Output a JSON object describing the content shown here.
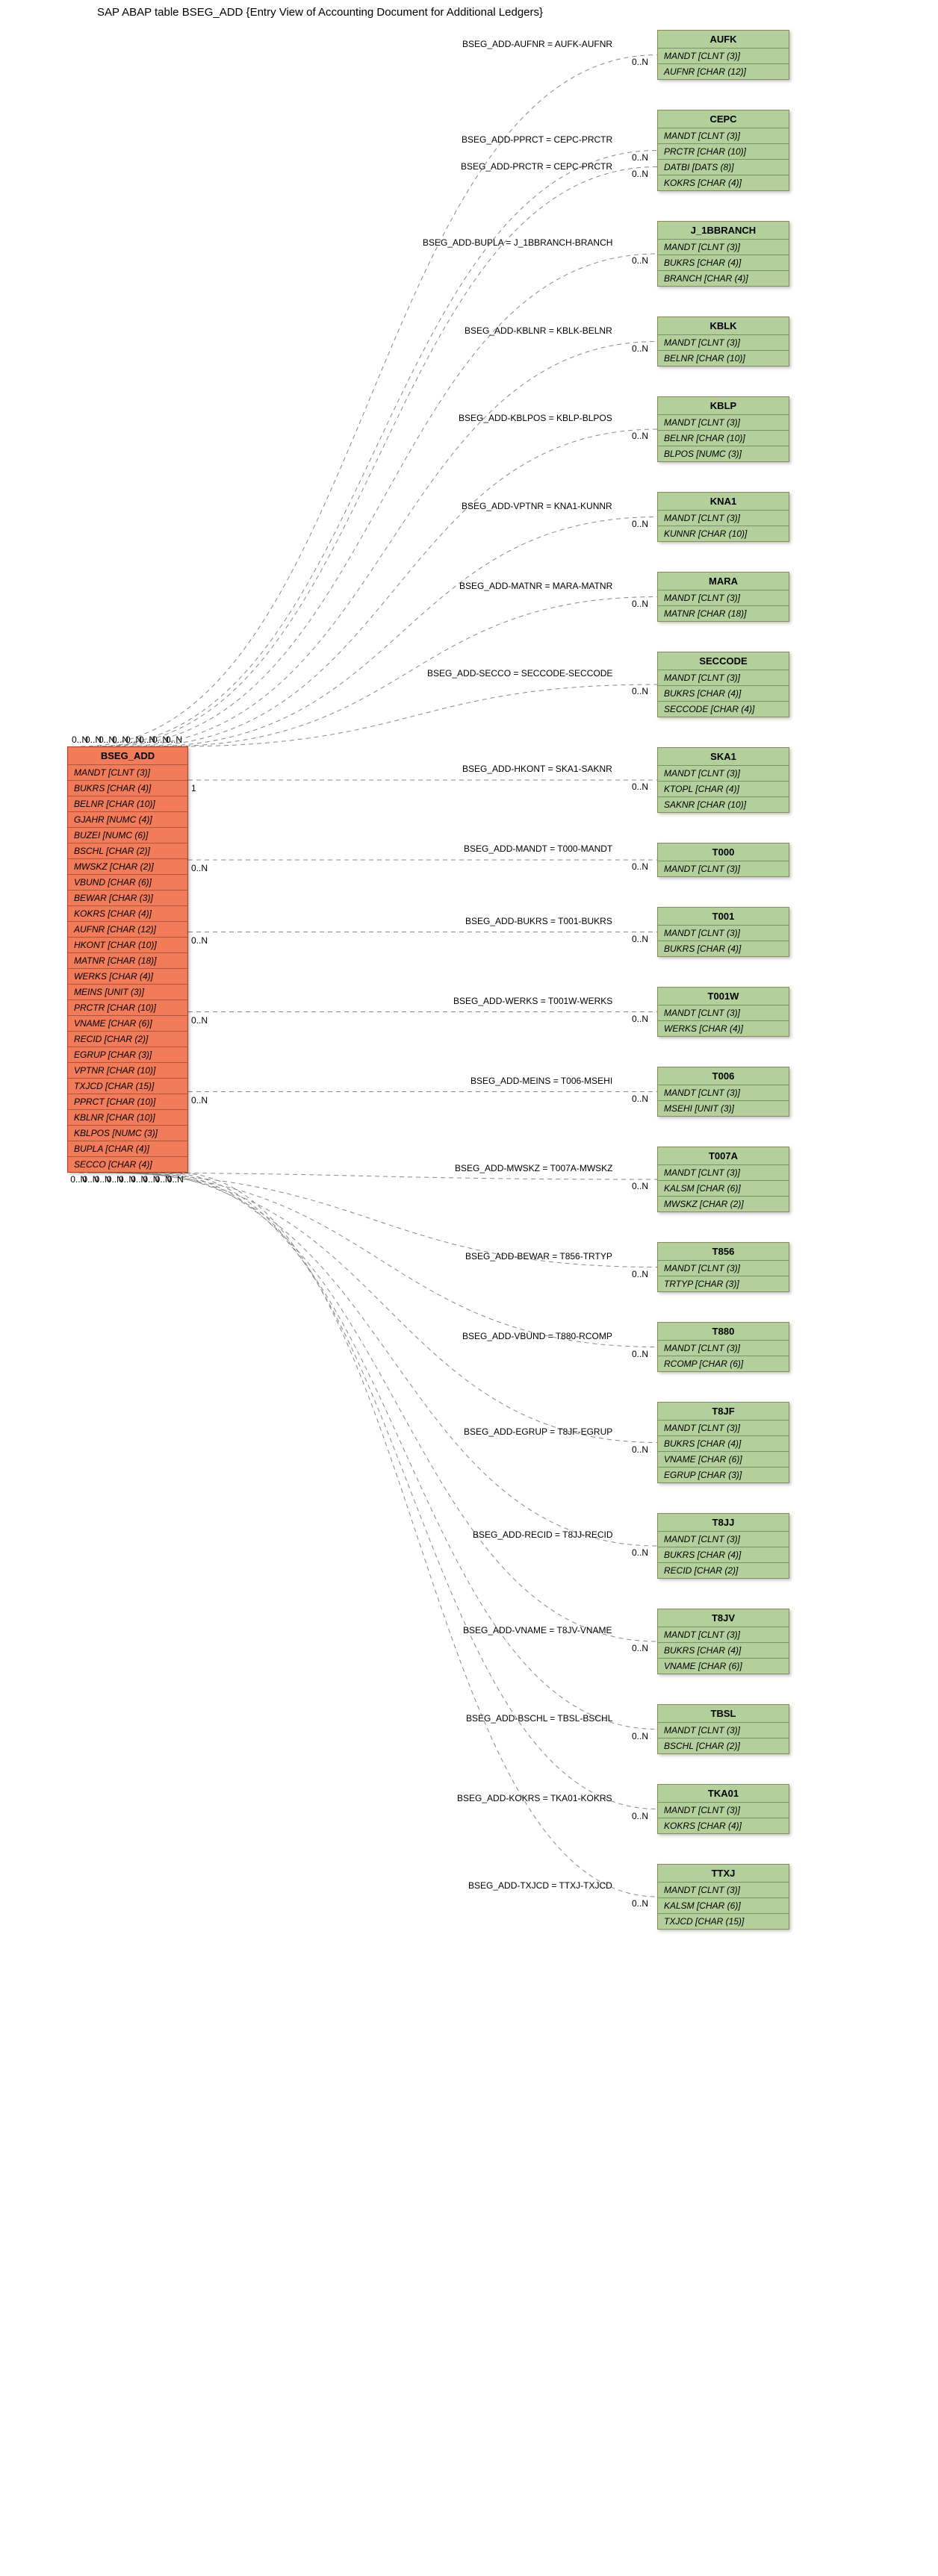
{
  "title": "SAP ABAP table BSEG_ADD {Entry View of Accounting Document for Additional Ledgers}",
  "main_entity": {
    "name": "BSEG_ADD",
    "fields": [
      "MANDT [CLNT (3)]",
      "BUKRS [CHAR (4)]",
      "BELNR [CHAR (10)]",
      "GJAHR [NUMC (4)]",
      "BUZEI [NUMC (6)]",
      "BSCHL [CHAR (2)]",
      "MWSKZ [CHAR (2)]",
      "VBUND [CHAR (6)]",
      "BEWAR [CHAR (3)]",
      "KOKRS [CHAR (4)]",
      "AUFNR [CHAR (12)]",
      "HKONT [CHAR (10)]",
      "MATNR [CHAR (18)]",
      "WERKS [CHAR (4)]",
      "MEINS [UNIT (3)]",
      "PRCTR [CHAR (10)]",
      "VNAME [CHAR (6)]",
      "RECID [CHAR (2)]",
      "EGRUP [CHAR (3)]",
      "VPTNR [CHAR (10)]",
      "TXJCD [CHAR (15)]",
      "PPRCT [CHAR (10)]",
      "KBLNR [CHAR (10)]",
      "KBLPOS [NUMC (3)]",
      "BUPLA [CHAR (4)]",
      "SECCO [CHAR (4)]"
    ]
  },
  "targets": [
    {
      "name": "AUFK",
      "fields": [
        "MANDT [CLNT (3)]",
        "AUFNR [CHAR (12)]"
      ],
      "rel_label": "BSEG_ADD-AUFNR = AUFK-AUFNR",
      "near_card": "0..N",
      "far_card": "0..N"
    },
    {
      "name": "CEPC",
      "fields": [
        "MANDT [CLNT (3)]",
        "PRCTR [CHAR (10)]",
        "DATBI [DATS (8)]",
        "KOKRS [CHAR (4)]"
      ],
      "rel_label": "BSEG_ADD-PPRCT = CEPC-PRCTR",
      "near_card": "0..N",
      "far_card": "0..N",
      "extra_rel_label": "BSEG_ADD-PRCTR = CEPC-PRCTR",
      "extra_near_card": "0..N",
      "extra_far_card": "0..N"
    },
    {
      "name": "J_1BBRANCH",
      "fields": [
        "MANDT [CLNT (3)]",
        "BUKRS [CHAR (4)]",
        "BRANCH [CHAR (4)]"
      ],
      "rel_label": "BSEG_ADD-BUPLA = J_1BBRANCH-BRANCH",
      "near_card": "0..N",
      "far_card": "0..N"
    },
    {
      "name": "KBLK",
      "fields": [
        "MANDT [CLNT (3)]",
        "BELNR [CHAR (10)]"
      ],
      "rel_label": "BSEG_ADD-KBLNR = KBLK-BELNR",
      "near_card": "0..N",
      "far_card": "0..N"
    },
    {
      "name": "KBLP",
      "fields": [
        "MANDT [CLNT (3)]",
        "BELNR [CHAR (10)]",
        "BLPOS [NUMC (3)]"
      ],
      "rel_label": "BSEG_ADD-KBLPOS = KBLP-BLPOS",
      "near_card": "0..N",
      "far_card": "0..N"
    },
    {
      "name": "KNA1",
      "fields": [
        "MANDT [CLNT (3)]",
        "KUNNR [CHAR (10)]"
      ],
      "rel_label": "BSEG_ADD-VPTNR = KNA1-KUNNR",
      "near_card": "0..N",
      "far_card": "0..N"
    },
    {
      "name": "MARA",
      "fields": [
        "MANDT [CLNT (3)]",
        "MATNR [CHAR (18)]"
      ],
      "rel_label": "BSEG_ADD-MATNR = MARA-MATNR",
      "near_card": "0..N",
      "far_card": "0..N"
    },
    {
      "name": "SECCODE",
      "fields": [
        "MANDT [CLNT (3)]",
        "BUKRS [CHAR (4)]",
        "SECCODE [CHAR (4)]"
      ],
      "rel_label": "BSEG_ADD-SECCO = SECCODE-SECCODE",
      "near_card": "0..N",
      "far_card": "0..N"
    },
    {
      "name": "SKA1",
      "fields": [
        "MANDT [CLNT (3)]",
        "KTOPL [CHAR (4)]",
        "SAKNR [CHAR (10)]"
      ],
      "rel_label": "BSEG_ADD-HKONT = SKA1-SAKNR",
      "near_card": "1",
      "far_card": "0..N"
    },
    {
      "name": "T000",
      "fields": [
        "MANDT [CLNT (3)]"
      ],
      "rel_label": "BSEG_ADD-MANDT = T000-MANDT",
      "near_card": "0..N",
      "far_card": "0..N"
    },
    {
      "name": "T001",
      "fields": [
        "MANDT [CLNT (3)]",
        "BUKRS [CHAR (4)]"
      ],
      "rel_label": "BSEG_ADD-BUKRS = T001-BUKRS",
      "near_card": "0..N",
      "far_card": "0..N"
    },
    {
      "name": "T001W",
      "fields": [
        "MANDT [CLNT (3)]",
        "WERKS [CHAR (4)]"
      ],
      "rel_label": "BSEG_ADD-WERKS = T001W-WERKS",
      "near_card": "0..N",
      "far_card": "0..N"
    },
    {
      "name": "T006",
      "fields": [
        "MANDT [CLNT (3)]",
        "MSEHI [UNIT (3)]"
      ],
      "rel_label": "BSEG_ADD-MEINS = T006-MSEHI",
      "near_card": "0..N",
      "far_card": "0..N"
    },
    {
      "name": "T007A",
      "fields": [
        "MANDT [CLNT (3)]",
        "KALSM [CHAR (6)]",
        "MWSKZ [CHAR (2)]"
      ],
      "rel_label": "BSEG_ADD-MWSKZ = T007A-MWSKZ",
      "near_card": "0..N",
      "far_card": "0..N"
    },
    {
      "name": "T856",
      "fields": [
        "MANDT [CLNT (3)]",
        "TRTYP [CHAR (3)]"
      ],
      "rel_label": "BSEG_ADD-BEWAR = T856-TRTYP",
      "near_card": "0..N",
      "far_card": "0..N"
    },
    {
      "name": "T880",
      "fields": [
        "MANDT [CLNT (3)]",
        "RCOMP [CHAR (6)]"
      ],
      "rel_label": "BSEG_ADD-VBUND = T880-RCOMP",
      "near_card": "0..N",
      "far_card": "0..N"
    },
    {
      "name": "T8JF",
      "fields": [
        "MANDT [CLNT (3)]",
        "BUKRS [CHAR (4)]",
        "VNAME [CHAR (6)]",
        "EGRUP [CHAR (3)]"
      ],
      "rel_label": "BSEG_ADD-EGRUP = T8JF-EGRUP",
      "near_card": "0..N",
      "far_card": "0..N"
    },
    {
      "name": "T8JJ",
      "fields": [
        "MANDT [CLNT (3)]",
        "BUKRS [CHAR (4)]",
        "RECID [CHAR (2)]"
      ],
      "rel_label": "BSEG_ADD-RECID = T8JJ-RECID",
      "near_card": "0..N",
      "far_card": "0..N"
    },
    {
      "name": "T8JV",
      "fields": [
        "MANDT [CLNT (3)]",
        "BUKRS [CHAR (4)]",
        "VNAME [CHAR (6)]"
      ],
      "rel_label": "BSEG_ADD-VNAME = T8JV-VNAME",
      "near_card": "0..N",
      "far_card": "0..N"
    },
    {
      "name": "TBSL",
      "fields": [
        "MANDT [CLNT (3)]",
        "BSCHL [CHAR (2)]"
      ],
      "rel_label": "BSEG_ADD-BSCHL = TBSL-BSCHL",
      "near_card": "0..N",
      "far_card": "0..N"
    },
    {
      "name": "TKA01",
      "fields": [
        "MANDT [CLNT (3)]",
        "KOKRS [CHAR (4)]"
      ],
      "rel_label": "BSEG_ADD-KOKRS = TKA01-KOKRS",
      "near_card": "0..N",
      "far_card": "0..N"
    },
    {
      "name": "TTXJ",
      "fields": [
        "MANDT [CLNT (3)]",
        "KALSM [CHAR (6)]",
        "TXJCD [CHAR (15)]"
      ],
      "rel_label": "BSEG_ADD-TXJCD = TTXJ-TXJCD",
      "near_card": "0..N",
      "far_card": "0..N"
    }
  ],
  "chart_data": {
    "type": "table",
    "description": "Entity-relationship diagram. Main table BSEG_ADD on the left (orange) connected via labeled dashed edges to 22 related tables on the right (green). Each edge label gives the join condition; cardinality text '0..N' (or '1' in one case) appears near each endpoint.",
    "main_table": "BSEG_ADD",
    "relations": [
      {
        "from": "BSEG_ADD",
        "field": "AUFNR",
        "to": "AUFK",
        "to_field": "AUFNR",
        "card_left": "0..N",
        "card_right": "0..N"
      },
      {
        "from": "BSEG_ADD",
        "field": "PPRCT",
        "to": "CEPC",
        "to_field": "PRCTR",
        "card_left": "0..N",
        "card_right": "0..N"
      },
      {
        "from": "BSEG_ADD",
        "field": "PRCTR",
        "to": "CEPC",
        "to_field": "PRCTR",
        "card_left": "0..N",
        "card_right": "0..N"
      },
      {
        "from": "BSEG_ADD",
        "field": "BUPLA",
        "to": "J_1BBRANCH",
        "to_field": "BRANCH",
        "card_left": "0..N",
        "card_right": "0..N"
      },
      {
        "from": "BSEG_ADD",
        "field": "KBLNR",
        "to": "KBLK",
        "to_field": "BELNR",
        "card_left": "0..N",
        "card_right": "0..N"
      },
      {
        "from": "BSEG_ADD",
        "field": "KBLPOS",
        "to": "KBLP",
        "to_field": "BLPOS",
        "card_left": "0..N",
        "card_right": "0..N"
      },
      {
        "from": "BSEG_ADD",
        "field": "VPTNR",
        "to": "KNA1",
        "to_field": "KUNNR",
        "card_left": "0..N",
        "card_right": "0..N"
      },
      {
        "from": "BSEG_ADD",
        "field": "MATNR",
        "to": "MARA",
        "to_field": "MATNR",
        "card_left": "0..N",
        "card_right": "0..N"
      },
      {
        "from": "BSEG_ADD",
        "field": "SECCO",
        "to": "SECCODE",
        "to_field": "SECCODE",
        "card_left": "0..N",
        "card_right": "0..N"
      },
      {
        "from": "BSEG_ADD",
        "field": "HKONT",
        "to": "SKA1",
        "to_field": "SAKNR",
        "card_left": "1",
        "card_right": "0..N"
      },
      {
        "from": "BSEG_ADD",
        "field": "MANDT",
        "to": "T000",
        "to_field": "MANDT",
        "card_left": "0..N",
        "card_right": "0..N"
      },
      {
        "from": "BSEG_ADD",
        "field": "BUKRS",
        "to": "T001",
        "to_field": "BUKRS",
        "card_left": "0..N",
        "card_right": "0..N"
      },
      {
        "from": "BSEG_ADD",
        "field": "WERKS",
        "to": "T001W",
        "to_field": "WERKS",
        "card_left": "0..N",
        "card_right": "0..N"
      },
      {
        "from": "BSEG_ADD",
        "field": "MEINS",
        "to": "T006",
        "to_field": "MSEHI",
        "card_left": "0..N",
        "card_right": "0..N"
      },
      {
        "from": "BSEG_ADD",
        "field": "MWSKZ",
        "to": "T007A",
        "to_field": "MWSKZ",
        "card_left": "0..N",
        "card_right": "0..N"
      },
      {
        "from": "BSEG_ADD",
        "field": "BEWAR",
        "to": "T856",
        "to_field": "TRTYP",
        "card_left": "0..N",
        "card_right": "0..N"
      },
      {
        "from": "BSEG_ADD",
        "field": "VBUND",
        "to": "T880",
        "to_field": "RCOMP",
        "card_left": "0..N",
        "card_right": "0..N"
      },
      {
        "from": "BSEG_ADD",
        "field": "EGRUP",
        "to": "T8JF",
        "to_field": "EGRUP",
        "card_left": "0..N",
        "card_right": "0..N"
      },
      {
        "from": "BSEG_ADD",
        "field": "RECID",
        "to": "T8JJ",
        "to_field": "RECID",
        "card_left": "0..N",
        "card_right": "0..N"
      },
      {
        "from": "BSEG_ADD",
        "field": "VNAME",
        "to": "T8JV",
        "to_field": "VNAME",
        "card_left": "0..N",
        "card_right": "0..N"
      },
      {
        "from": "BSEG_ADD",
        "field": "BSCHL",
        "to": "TBSL",
        "to_field": "BSCHL",
        "card_left": "0..N",
        "card_right": "0..N"
      },
      {
        "from": "BSEG_ADD",
        "field": "KOKRS",
        "to": "TKA01",
        "to_field": "KOKRS",
        "card_left": "0..N",
        "card_right": "0..N"
      },
      {
        "from": "BSEG_ADD",
        "field": "TXJCD",
        "to": "TTXJ",
        "to_field": "TXJCD",
        "card_left": "0..N",
        "card_right": "0..N"
      }
    ]
  }
}
